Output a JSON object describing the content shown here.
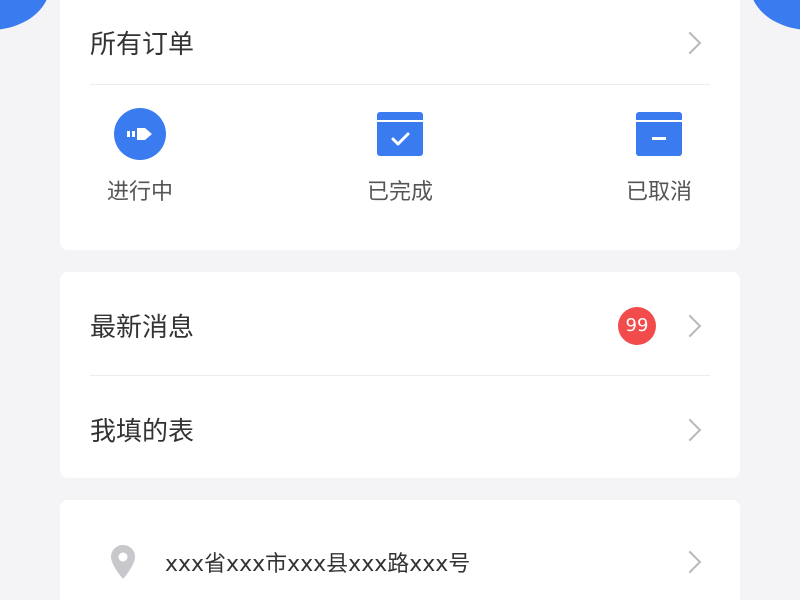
{
  "orders": {
    "title": "所有订单",
    "statuses": [
      {
        "label": "进行中",
        "icon": "arrow-right-icon"
      },
      {
        "label": "已完成",
        "icon": "check-box-icon"
      },
      {
        "label": "已取消",
        "icon": "minus-box-icon"
      }
    ]
  },
  "menu": {
    "items": [
      {
        "label": "最新消息",
        "badge": "99"
      },
      {
        "label": "我填的表"
      }
    ]
  },
  "address": {
    "text": "xxx省xxx市xxx县xxx路xxx号"
  },
  "colors": {
    "accent": "#3a7bf0",
    "badge": "#f24b4b",
    "background": "#f4f4f6"
  }
}
